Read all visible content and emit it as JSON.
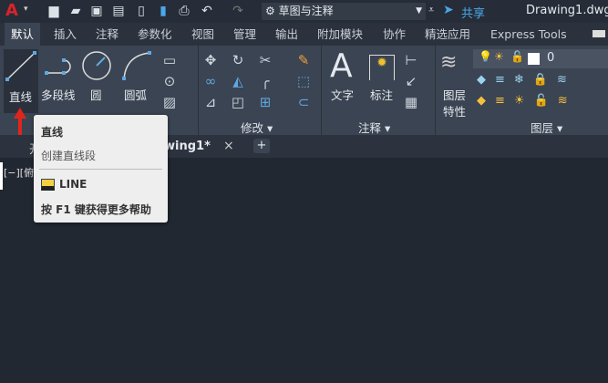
{
  "title": {
    "app_logo": "A",
    "workspace": "草图与注释",
    "share": "共享",
    "filename": "Drawing1.dwg"
  },
  "ribbon_tabs": [
    "默认",
    "插入",
    "注释",
    "参数化",
    "视图",
    "管理",
    "输出",
    "附加模块",
    "协作",
    "精选应用",
    "Express Tools"
  ],
  "draw": {
    "line": "直线",
    "polyline": "多段线",
    "circle": "圆",
    "arc": "圆弧"
  },
  "panels": {
    "modify": "修改",
    "annotate": "注释",
    "layers": "图层"
  },
  "annotate": {
    "text": "文字",
    "dimension": "标注"
  },
  "layers": {
    "properties_1": "图层",
    "properties_2": "特性",
    "current_layer": "0"
  },
  "file_tabs": {
    "start_partial": "开",
    "drawing": "wing1*",
    "close": "×",
    "add": "+"
  },
  "viewport_label": "[−][俯",
  "tooltip": {
    "title": "直线",
    "desc": "创建直线段",
    "command": "LINE",
    "help": "按 F1 键获得更多帮助"
  },
  "colors": {
    "accent": "#2f9be0",
    "arrow": "#e0261c"
  }
}
